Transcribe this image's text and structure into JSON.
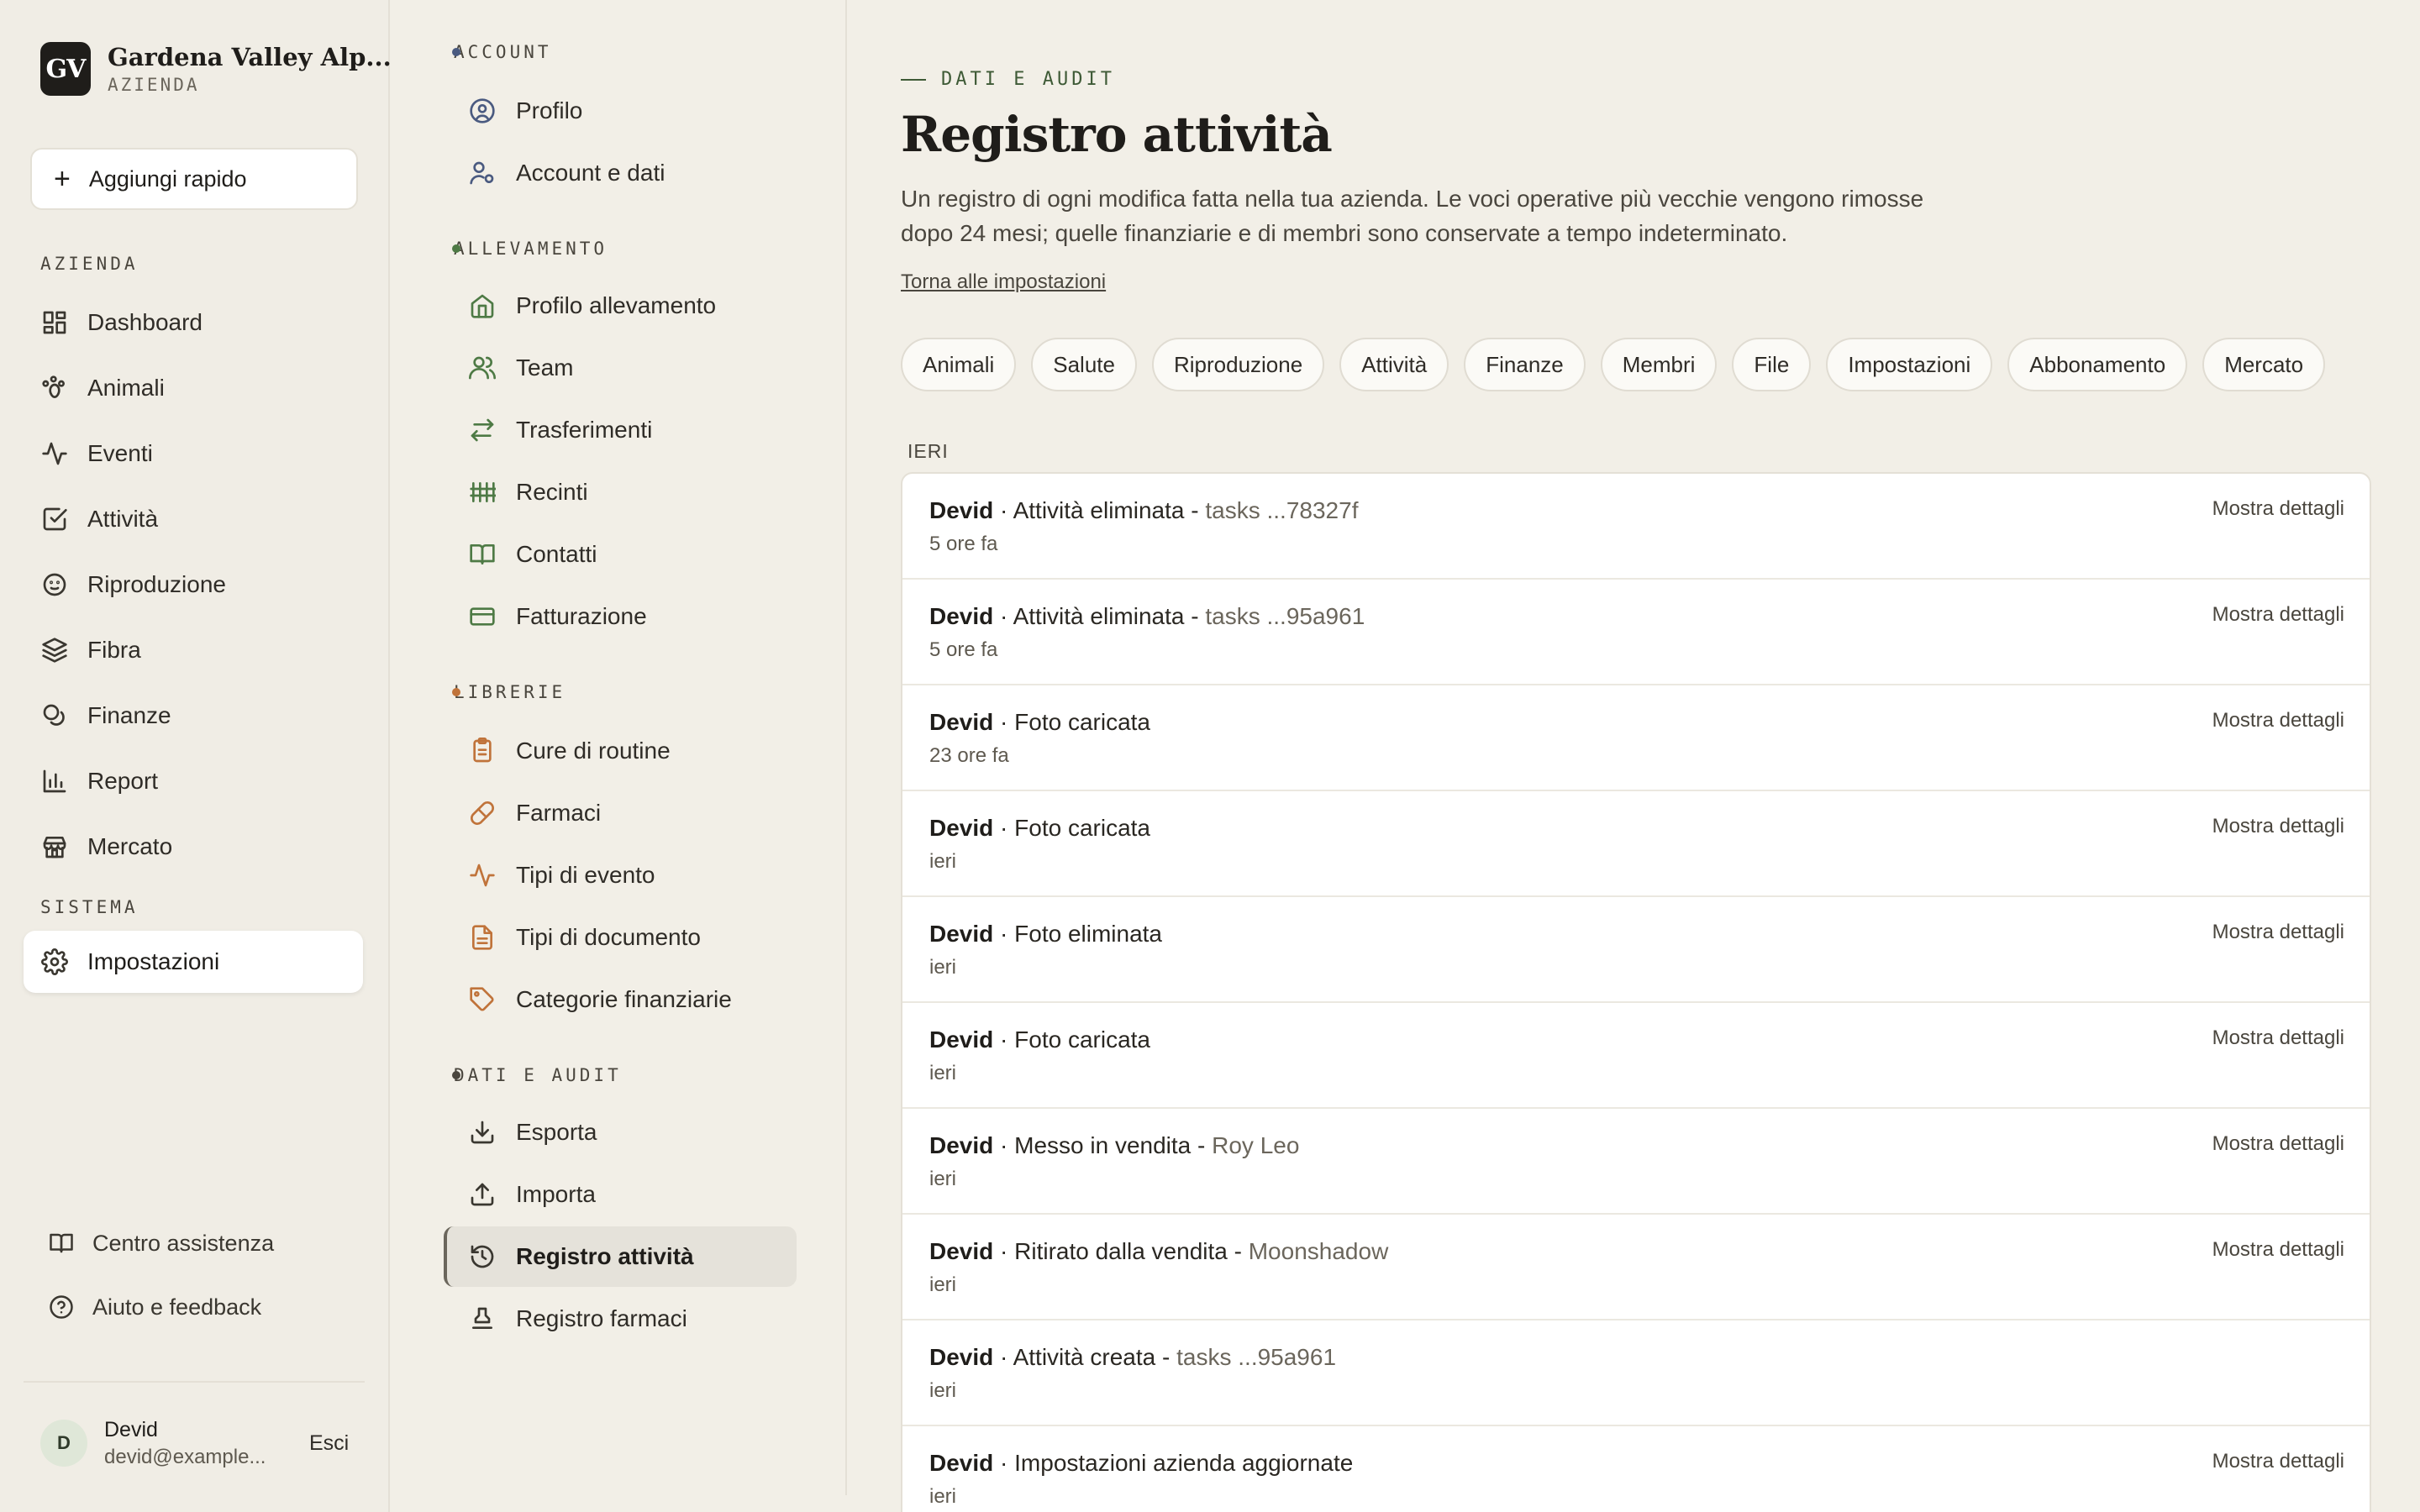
{
  "brand": {
    "initials": "GV",
    "name": "Gardena Valley Alp...",
    "subtitle": "AZIENDA"
  },
  "quick_add": {
    "label": "Aggiungi rapido"
  },
  "sidebar": {
    "section_farm": "AZIENDA",
    "section_system": "SISTEMA",
    "items": [
      {
        "label": "Dashboard",
        "icon": "grid-icon"
      },
      {
        "label": "Animali",
        "icon": "paw-icon"
      },
      {
        "label": "Eventi",
        "icon": "activity-icon"
      },
      {
        "label": "Attività",
        "icon": "checkbox-icon"
      },
      {
        "label": "Riproduzione",
        "icon": "baby-icon"
      },
      {
        "label": "Fibra",
        "icon": "layers-icon"
      },
      {
        "label": "Finanze",
        "icon": "coins-icon"
      },
      {
        "label": "Report",
        "icon": "bar-chart-icon"
      },
      {
        "label": "Mercato",
        "icon": "store-icon"
      }
    ],
    "settings_label": "Impostazioni",
    "help_center": "Centro assistenza",
    "help_feedback": "Aiuto e feedback"
  },
  "user": {
    "initial": "D",
    "name": "Devid",
    "email": "devid@example...",
    "logout": "Esci"
  },
  "subnav": {
    "sections": [
      {
        "label": "ACCOUNT",
        "color": "#4a5a80",
        "items": [
          "Profilo",
          "Account e dati"
        ]
      },
      {
        "label": "ALLEVAMENTO",
        "color": "#4e7a45",
        "items": [
          "Profilo allevamento",
          "Team",
          "Trasferimenti",
          "Recinti",
          "Contatti",
          "Fatturazione"
        ]
      },
      {
        "label": "LIBRERIE",
        "color": "#c0733a",
        "items": [
          "Cure di routine",
          "Farmaci",
          "Tipi di evento",
          "Tipi di documento",
          "Categorie finanziarie"
        ]
      },
      {
        "label": "DATI E AUDIT",
        "color": "#4a463e",
        "items": [
          "Esporta",
          "Importa",
          "Registro attività",
          "Registro farmaci"
        ]
      }
    ]
  },
  "page": {
    "eyebrow": "DATI E AUDIT",
    "title": "Registro attività",
    "description": "Un registro di ogni modifica fatta nella tua azienda. Le voci operative più vecchie vengono rimosse dopo 24 mesi; quelle finanziarie e di membri sono conservate a tempo indeterminato.",
    "back_link": "Torna alle impostazioni",
    "filters": [
      "Animali",
      "Salute",
      "Riproduzione",
      "Attività",
      "Finanze",
      "Membri",
      "File",
      "Impostazioni",
      "Abbonamento",
      "Mercato"
    ],
    "group_label": "IERI",
    "details_label": "Mostra dettagli",
    "entries": [
      {
        "who": "Devid",
        "action": "Attività eliminata",
        "target": "tasks ...78327f",
        "time": "5 ore fa",
        "details": true
      },
      {
        "who": "Devid",
        "action": "Attività eliminata",
        "target": "tasks ...95a961",
        "time": "5 ore fa",
        "details": true
      },
      {
        "who": "Devid",
        "action": "Foto caricata",
        "target": "",
        "time": "23 ore fa",
        "details": true
      },
      {
        "who": "Devid",
        "action": "Foto caricata",
        "target": "",
        "time": "ieri",
        "details": true
      },
      {
        "who": "Devid",
        "action": "Foto eliminata",
        "target": "",
        "time": "ieri",
        "details": true
      },
      {
        "who": "Devid",
        "action": "Foto caricata",
        "target": "",
        "time": "ieri",
        "details": true
      },
      {
        "who": "Devid",
        "action": "Messo in vendita",
        "target": "Roy Leo",
        "time": "ieri",
        "details": true
      },
      {
        "who": "Devid",
        "action": "Ritirato dalla vendita",
        "target": "Moonshadow",
        "time": "ieri",
        "details": true
      },
      {
        "who": "Devid",
        "action": "Attività creata",
        "target": "tasks ...95a961",
        "time": "ieri",
        "details": false
      },
      {
        "who": "Devid",
        "action": "Impostazioni azienda aggiornate",
        "target": "",
        "time": "ieri",
        "details": true
      }
    ]
  }
}
